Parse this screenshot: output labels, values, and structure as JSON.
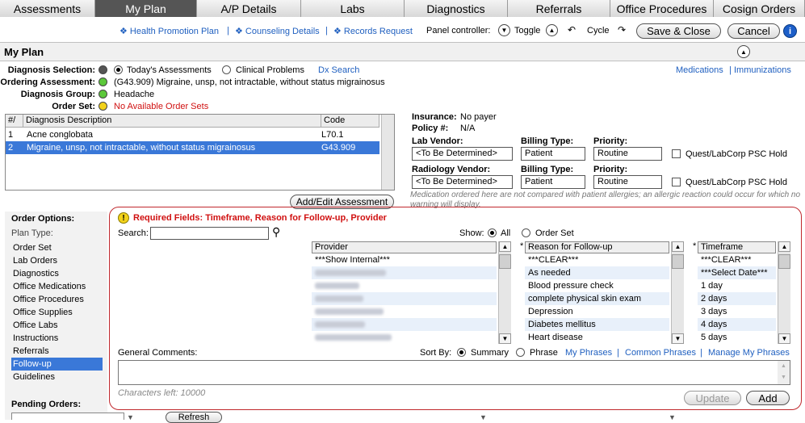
{
  "tabs": [
    "Assessments",
    "My Plan",
    "A/P Details",
    "Labs",
    "Diagnostics",
    "Referrals",
    "Office Procedures",
    "Cosign Orders"
  ],
  "toplinks": {
    "health_promotion": "❖ Health Promotion Plan",
    "sep1": "|",
    "counseling": "❖ Counseling Details",
    "sep2": "|",
    "records": "❖ Records Request",
    "panel_controller": "Panel controller:",
    "toggle": "Toggle",
    "cycle": "Cycle",
    "save_close": "Save & Close",
    "cancel": "Cancel",
    "help": "i"
  },
  "title": "My Plan",
  "diagnosis": {
    "selection_label": "Diagnosis Selection:",
    "opt_today": "Today's Assessments",
    "opt_clinical": "Clinical Problems",
    "dx_search": "Dx Search",
    "ordering_label": "Ordering Assessment:",
    "ordering_value": "(G43.909) Migraine, unsp, not intractable, without status migrainosus",
    "group_label": "Diagnosis Group:",
    "group_value": "Headache",
    "orderset_label": "Order Set:",
    "orderset_value": "No Available Order Sets",
    "meds_link": "Medications",
    "sep": "|",
    "immunizations_link": "Immunizations"
  },
  "diag_table": {
    "headers": [
      "#/",
      "Diagnosis Description",
      "Code"
    ],
    "rows": [
      {
        "num": "1",
        "desc": "Acne conglobata",
        "code": "L70.1"
      },
      {
        "num": "2",
        "desc": "Migraine, unsp, not intractable, without status migrainosus",
        "code": "G43.909"
      }
    ],
    "add_edit": "Add/Edit Assessment"
  },
  "insurance": {
    "insurance_label": "Insurance:",
    "insurance_value": "No payer",
    "policy_label": "Policy #:",
    "policy_value": "N/A",
    "lab_vendor_label": "Lab Vendor:",
    "lab_vendor_value": "<To Be Determined>",
    "billing_label": "Billing Type:",
    "billing_value": "Patient",
    "priority_label": "Priority:",
    "priority_value": "Routine",
    "quest_label": "Quest/LabCorp PSC Hold",
    "radiology_label": "Radiology Vendor:",
    "radiology_value": "<To Be Determined>",
    "billing2_label": "Billing Type:",
    "billing2_value": "Patient",
    "priority2_label": "Priority:",
    "priority2_value": "Routine",
    "quest2_label": "Quest/LabCorp PSC Hold",
    "warning": "Medication ordered here are not compared with patient allergies; an allergic reaction could occur for which no warning will display."
  },
  "order_options": {
    "title": "Order Options:",
    "plan_type": "Plan Type:",
    "items": [
      "Order Set",
      "Lab Orders",
      "Diagnostics",
      "Office Medications",
      "Office Procedures",
      "Office Supplies",
      "Office Labs",
      "Instructions",
      "Referrals",
      "Follow-up",
      "Guidelines"
    ],
    "pending": "Pending Orders:",
    "refresh": "Refresh"
  },
  "followup": {
    "required": "Required Fields: Timeframe, Reason for Follow-up, Provider",
    "search_label": "Search:",
    "show_label": "Show:",
    "show_all": "All",
    "show_orderset": "Order Set",
    "provider_header": "Provider",
    "provider_items": [
      "***Show Internal***"
    ],
    "reason_header": "Reason for Follow-up",
    "reason_items": [
      "***CLEAR***",
      "As needed",
      "Blood pressure check",
      "complete physical skin exam",
      "Depression",
      "Diabetes mellitus",
      "Heart disease"
    ],
    "timeframe_header": "Timeframe",
    "timeframe_items": [
      "***CLEAR***",
      "***Select Date***",
      "1 day",
      "2 days",
      "3 days",
      "4 days",
      "5 days"
    ],
    "star": "*",
    "general_comments": "General Comments:",
    "sort_by": "Sort By:",
    "sort_summary": "Summary",
    "sort_phrase": "Phrase",
    "my_phrases": "My Phrases",
    "common_phrases": "Common Phrases",
    "manage_phrases": "Manage My Phrases",
    "sep": "|",
    "chars_left": "Characters left: 10000",
    "update": "Update",
    "add": "Add"
  },
  "colors": {
    "accent_blue": "#3a78d8",
    "required_red": "#d01010",
    "panel_border": "#c0282d",
    "status_green": "#5cc83a",
    "status_yellow": "#f2d21b"
  }
}
